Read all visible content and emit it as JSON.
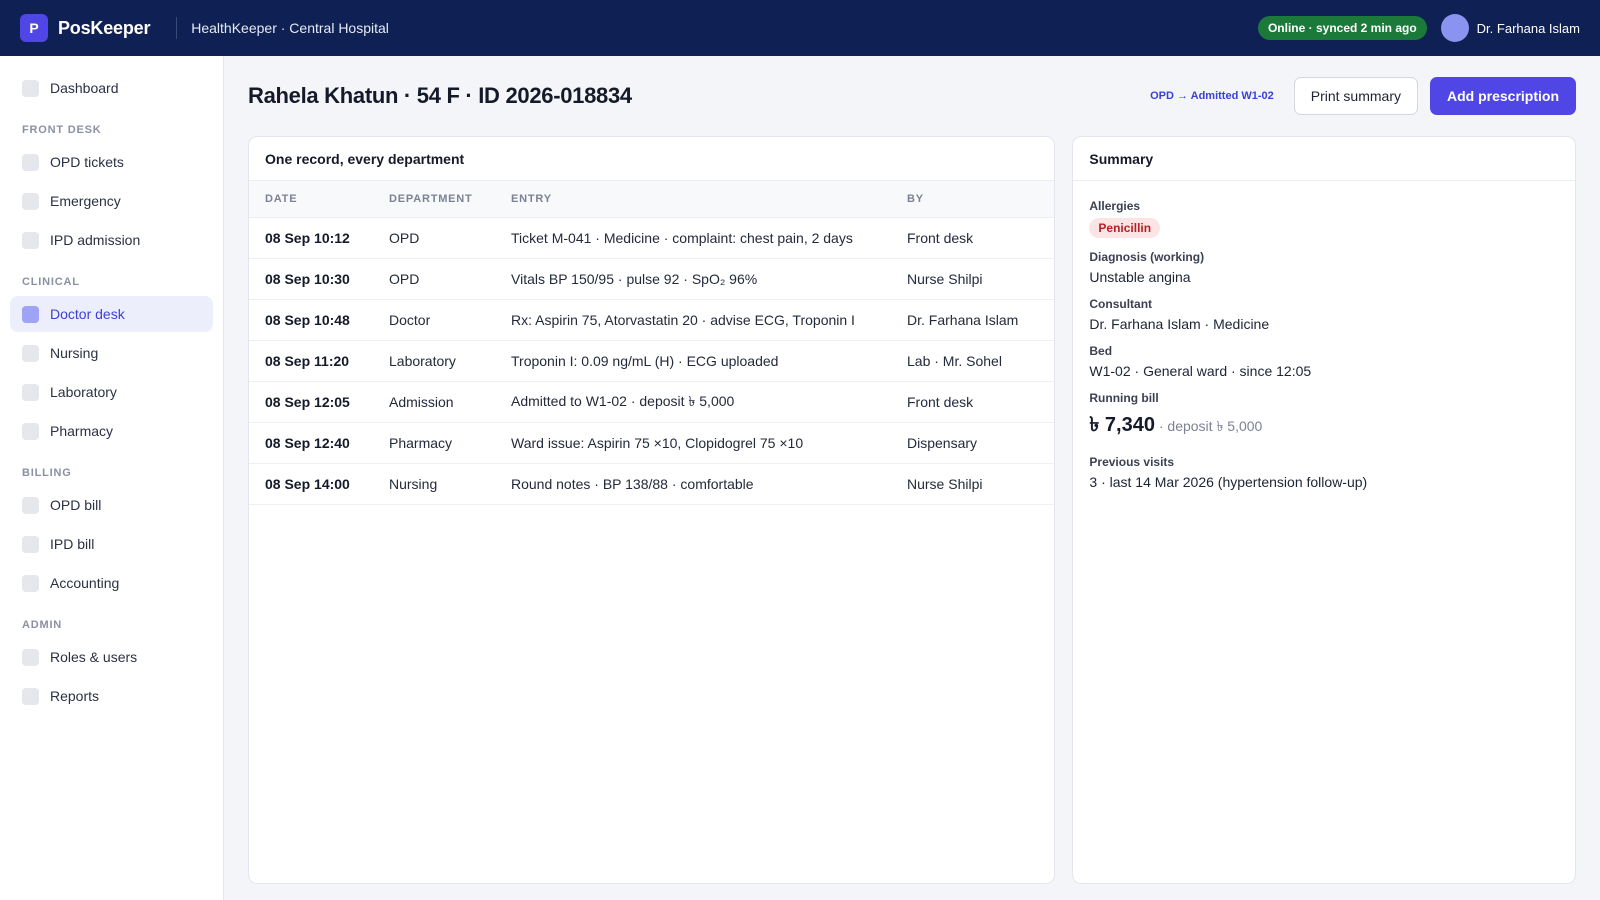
{
  "topbar": {
    "logo_letter": "P",
    "brand": "PosKeeper",
    "org": "HealthKeeper · Central Hospital",
    "status": "Online · synced 2 min ago",
    "user_name": "Dr. Farhana Islam"
  },
  "sidebar": {
    "dashboard": "Dashboard",
    "sections": {
      "front_desk": "FRONT DESK",
      "clinical": "CLINICAL",
      "billing": "BILLING",
      "admin": "ADMIN"
    },
    "items": {
      "opd_tickets": "OPD tickets",
      "emergency": "Emergency",
      "ipd_admission": "IPD admission",
      "doctor_desk": "Doctor desk",
      "nursing": "Nursing",
      "laboratory": "Laboratory",
      "pharmacy": "Pharmacy",
      "opd_bill": "OPD bill",
      "ipd_bill": "IPD bill",
      "accounting": "Accounting",
      "roles_users": "Roles & users",
      "reports": "Reports"
    },
    "active_item": "Doctor desk"
  },
  "header": {
    "title": "Rahela Khatun · 54 F · ID 2026-018834",
    "flow_tag": "OPD → Admitted W1-02",
    "print_button": "Print summary",
    "add_button": "Add prescription"
  },
  "records": {
    "title": "One record, every department",
    "columns": [
      "DATE",
      "DEPARTMENT",
      "ENTRY",
      "BY"
    ],
    "rows": [
      {
        "date": "08 Sep 10:12",
        "dept": "OPD",
        "entry": "Ticket M-041 · Medicine · complaint: chest pain, 2 days",
        "by": "Front desk"
      },
      {
        "date": "08 Sep 10:30",
        "dept": "OPD",
        "entry": "Vitals BP 150/95 · pulse 92 · SpO₂ 96%",
        "by": "Nurse Shilpi"
      },
      {
        "date": "08 Sep 10:48",
        "dept": "Doctor",
        "entry": "Rx: Aspirin 75, Atorvastatin 20 · advise ECG, Troponin I",
        "by": "Dr. Farhana Islam"
      },
      {
        "date": "08 Sep 11:20",
        "dept": "Laboratory",
        "entry": "Troponin I: 0.09 ng/mL (H) · ECG uploaded",
        "by": "Lab · Mr. Sohel"
      },
      {
        "date": "08 Sep 12:05",
        "dept": "Admission",
        "entry": "Admitted to W1-02 · deposit ৳ 5,000",
        "by": "Front desk"
      },
      {
        "date": "08 Sep 12:40",
        "dept": "Pharmacy",
        "entry": "Ward issue: Aspirin 75 ×10, Clopidogrel 75 ×10",
        "by": "Dispensary"
      },
      {
        "date": "08 Sep 14:00",
        "dept": "Nursing",
        "entry": "Round notes · BP 138/88 · comfortable",
        "by": "Nurse Shilpi"
      }
    ]
  },
  "summary": {
    "title": "Summary",
    "allergies_label": "Allergies",
    "allergy": "Penicillin",
    "diagnosis_label": "Diagnosis (working)",
    "diagnosis": "Unstable angina",
    "consultant_label": "Consultant",
    "consultant": "Dr. Farhana Islam · Medicine",
    "bed_label": "Bed",
    "bed": "W1-02 · General ward · since 12:05",
    "bill_label": "Running bill",
    "bill_amount": "৳ 7,340",
    "bill_deposit": "· deposit ৳ 5,000",
    "visits_label": "Previous visits",
    "visits": "3 · last 14 Mar 2026 (hypertension follow-up)"
  },
  "colors": {
    "topbar_bg": "#0f2154",
    "accent": "#4f46e5",
    "online_green": "#1b7a3a",
    "allergy_red": "#b42323"
  }
}
